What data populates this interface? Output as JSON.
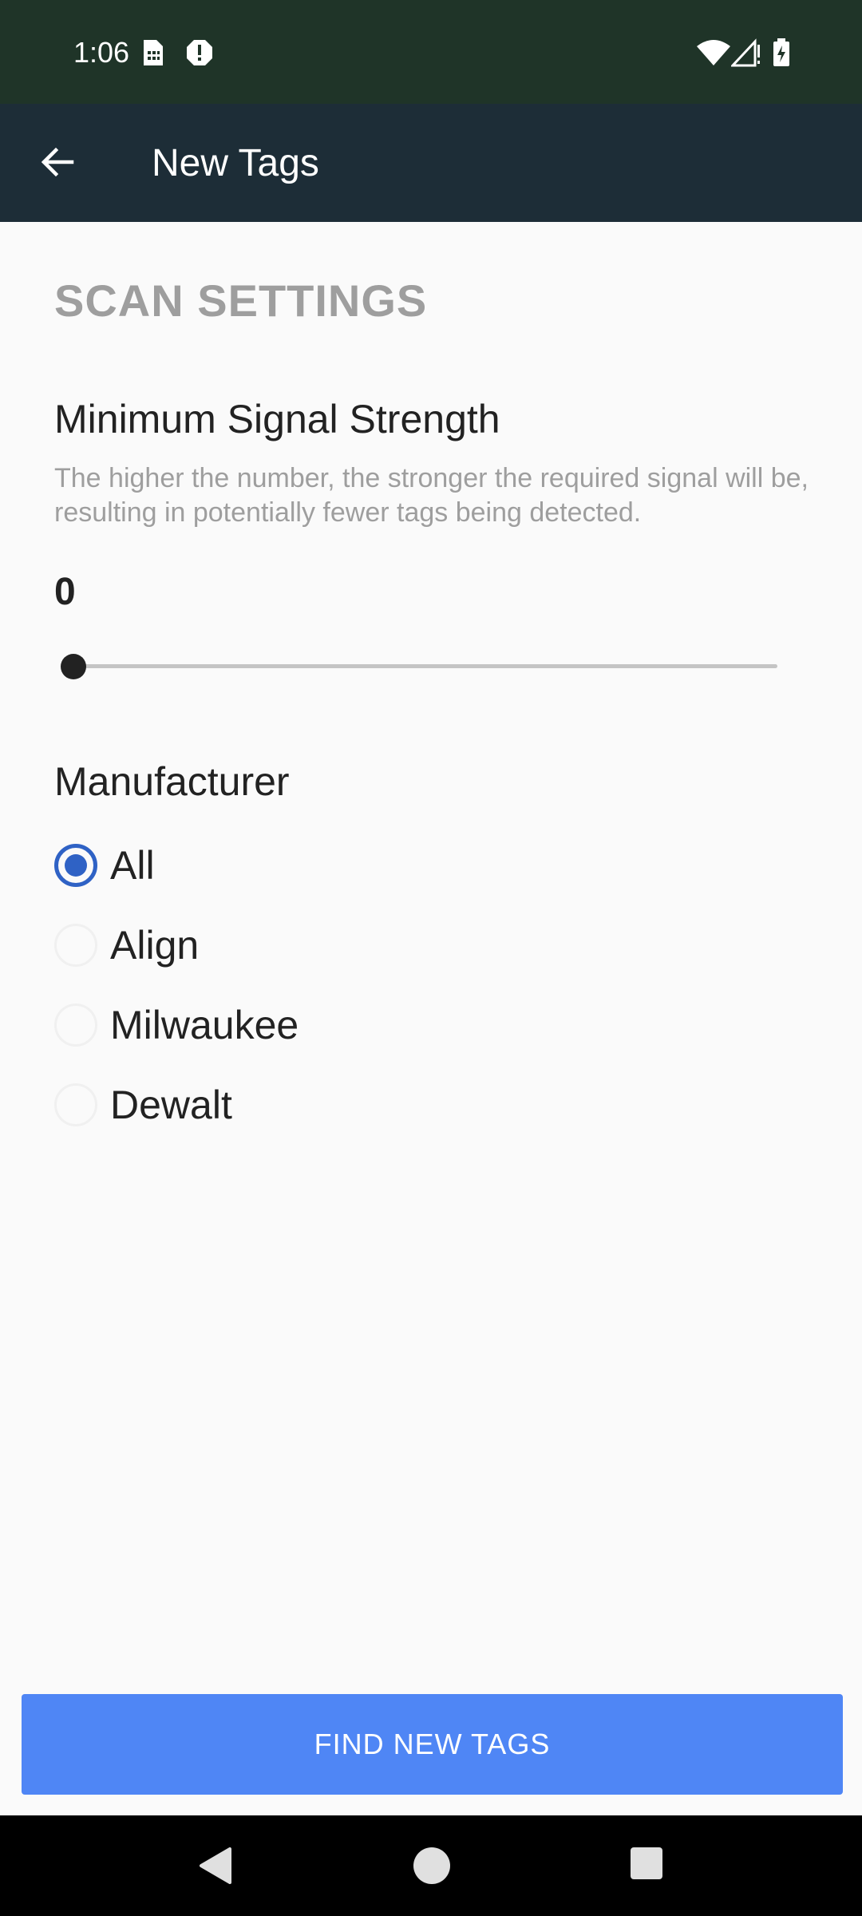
{
  "status_bar": {
    "time": "1:06",
    "icons": [
      "sim-card-icon",
      "alert-icon",
      "wifi-icon",
      "signal-icon",
      "battery-charging-icon"
    ]
  },
  "app_bar": {
    "title": "New Tags",
    "back_icon": "back-arrow-icon"
  },
  "scan_settings": {
    "section_title": "SCAN SETTINGS",
    "signal": {
      "title": "Minimum Signal Strength",
      "description": "The higher the number, the stronger the required signal will be, resulting in potentially fewer tags being detected.",
      "value": "0",
      "slider_fraction": 0
    },
    "manufacturer": {
      "title": "Manufacturer",
      "options": [
        {
          "label": "All",
          "checked": true
        },
        {
          "label": "Align",
          "checked": false
        },
        {
          "label": "Milwaukee",
          "checked": false
        },
        {
          "label": "Dewalt",
          "checked": false
        }
      ]
    }
  },
  "actions": {
    "find_label": "FIND NEW TAGS"
  },
  "colors": {
    "status_bar": "#1f3428",
    "app_bar": "#1d2d37",
    "accent": "#2f62c5",
    "button": "#4f86f5"
  },
  "nav_bar": {
    "icons": [
      "nav-back-icon",
      "nav-home-icon",
      "nav-recents-icon"
    ]
  }
}
